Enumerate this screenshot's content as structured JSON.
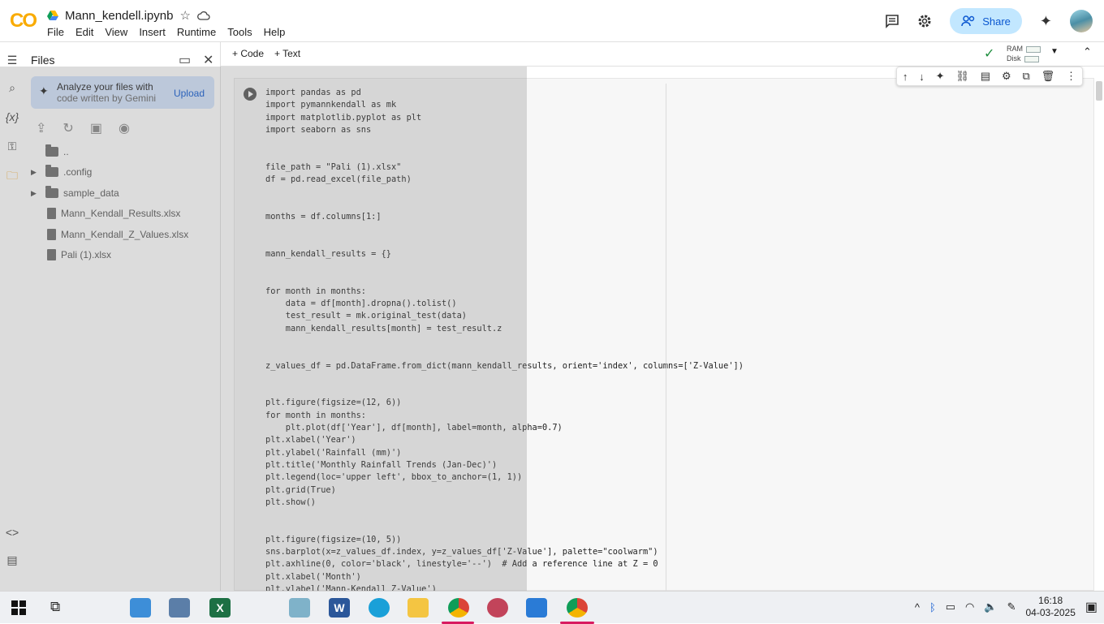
{
  "app": {
    "logo": "CO",
    "notebook_title": "Mann_kendell.ipynb"
  },
  "menu": [
    "File",
    "Edit",
    "View",
    "Insert",
    "Runtime",
    "Tools",
    "Help"
  ],
  "header_right": {
    "share_label": "Share"
  },
  "toolbar": {
    "code_label": "+ Code",
    "text_label": "+ Text",
    "ram_label": "RAM",
    "disk_label": "Disk"
  },
  "files_panel": {
    "title": "Files",
    "gemini_line1": "Analyze your files with",
    "gemini_line2": "code written by Gemini",
    "upload_label": "Upload",
    "items": [
      {
        "type": "folder",
        "name": "..",
        "expandable": false
      },
      {
        "type": "folder",
        "name": ".config",
        "expandable": true
      },
      {
        "type": "folder",
        "name": "sample_data",
        "expandable": true
      },
      {
        "type": "file",
        "name": "Mann_Kendall_Results.xlsx"
      },
      {
        "type": "file",
        "name": "Mann_Kendall_Z_Values.xlsx"
      },
      {
        "type": "file",
        "name": "Pali (1).xlsx"
      }
    ],
    "disk_status": "Disk"
  },
  "code_cell": {
    "lines": [
      "import pandas as pd",
      "import pymannkendall as mk",
      "import matplotlib.pyplot as plt",
      "import seaborn as sns",
      "",
      "",
      "file_path = \"Pali (1).xlsx\"",
      "df = pd.read_excel(file_path)",
      "",
      "",
      "months = df.columns[1:]",
      "",
      "",
      "mann_kendall_results = {}",
      "",
      "",
      "for month in months:",
      "    data = df[month].dropna().tolist()",
      "    test_result = mk.original_test(data)",
      "    mann_kendall_results[month] = test_result.z",
      "",
      "",
      "z_values_df = pd.DataFrame.from_dict(mann_kendall_results, orient='index', columns=['Z-Value'])",
      "",
      "",
      "plt.figure(figsize=(12, 6))",
      "for month in months:",
      "    plt.plot(df['Year'], df[month], label=month, alpha=0.7)",
      "plt.xlabel('Year')",
      "plt.ylabel('Rainfall (mm)')",
      "plt.title('Monthly Rainfall Trends (Jan-Dec)')",
      "plt.legend(loc='upper left', bbox_to_anchor=(1, 1))",
      "plt.grid(True)",
      "plt.show()",
      "",
      "",
      "plt.figure(figsize=(10, 5))",
      "sns.barplot(x=z_values_df.index, y=z_values_df['Z-Value'], palette=\"coolwarm\")",
      "plt.axhline(0, color='black', linestyle='--')  # Add a reference line at Z = 0",
      "plt.xlabel('Month')",
      "plt.ylabel('Mann-Kendall Z-Value')"
    ]
  },
  "taskbar": {
    "time": "16:18",
    "date": "04-03-2025"
  },
  "colors": {
    "accent": "#0b57d0",
    "share_bg": "#c2e7ff",
    "logo": "#f9ab00"
  }
}
